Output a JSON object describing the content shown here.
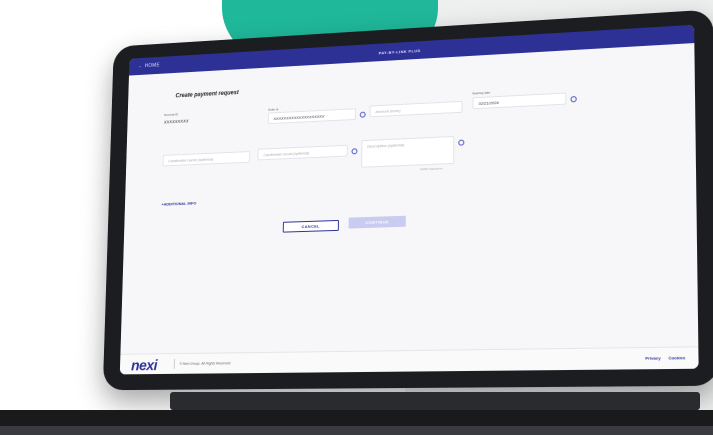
{
  "colors": {
    "brand": "#2d3196",
    "accent_teal": "#1fb89a"
  },
  "header": {
    "back_icon": "arrow-left-icon",
    "back_label": "HOME",
    "title": "PAY-BY-LINK PLUS"
  },
  "form": {
    "title": "Create payment request",
    "terminal_label": "Terminal ID",
    "terminal_value": "XXXXXXXXX",
    "order_label": "Order id",
    "order_value": "XXXXXXXXXXXXXXXXXXXX",
    "amount_placeholder": "Amount (euro)",
    "expiry_label": "Expiring date",
    "expiry_value": "02/21/2024",
    "cardholder_name_placeholder": "Cardholder name (optional)",
    "cardholder_email_placeholder": "Cardholder email (optional)",
    "description_placeholder": "Description (optional)",
    "description_counter": "0/255 characters",
    "additional_info": "+ADDITIONAL INFO",
    "info_icon": "info-circle-icon"
  },
  "buttons": {
    "cancel": "CANCEL",
    "continue": "CONTINUE"
  },
  "footer": {
    "logo": "nexi",
    "copyright": "© Nexi Group. All Rights Reserved.",
    "privacy": "Privacy",
    "cookies": "Cookies"
  }
}
